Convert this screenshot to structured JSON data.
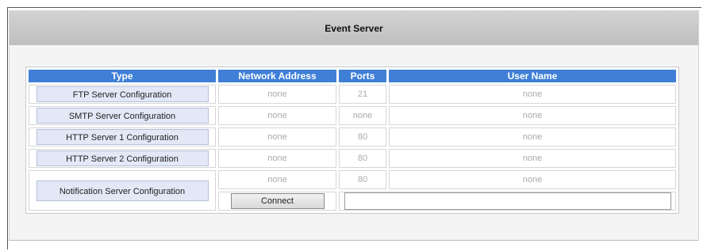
{
  "header": {
    "title": "Event Server"
  },
  "table": {
    "columns": [
      "Type",
      "Network Address",
      "Ports",
      "User Name"
    ],
    "rows": [
      {
        "type": "FTP Server Configuration",
        "address": "none",
        "port": "21",
        "user": "none"
      },
      {
        "type": "SMTP Server Configuration",
        "address": "none",
        "port": "none",
        "user": "none"
      },
      {
        "type": "HTTP Server 1 Configuration",
        "address": "none",
        "port": "80",
        "user": "none"
      },
      {
        "type": "HTTP Server 2 Configuration",
        "address": "none",
        "port": "80",
        "user": "none"
      },
      {
        "type": "Notification Server Configuration",
        "address": "none",
        "port": "80",
        "user": "none"
      }
    ],
    "connect_label": "Connect",
    "result_value": ""
  },
  "colors": {
    "header_blue": "#3f7fd6",
    "title_bar": "#c8c8c8",
    "config_button": "#e3e8f7"
  }
}
